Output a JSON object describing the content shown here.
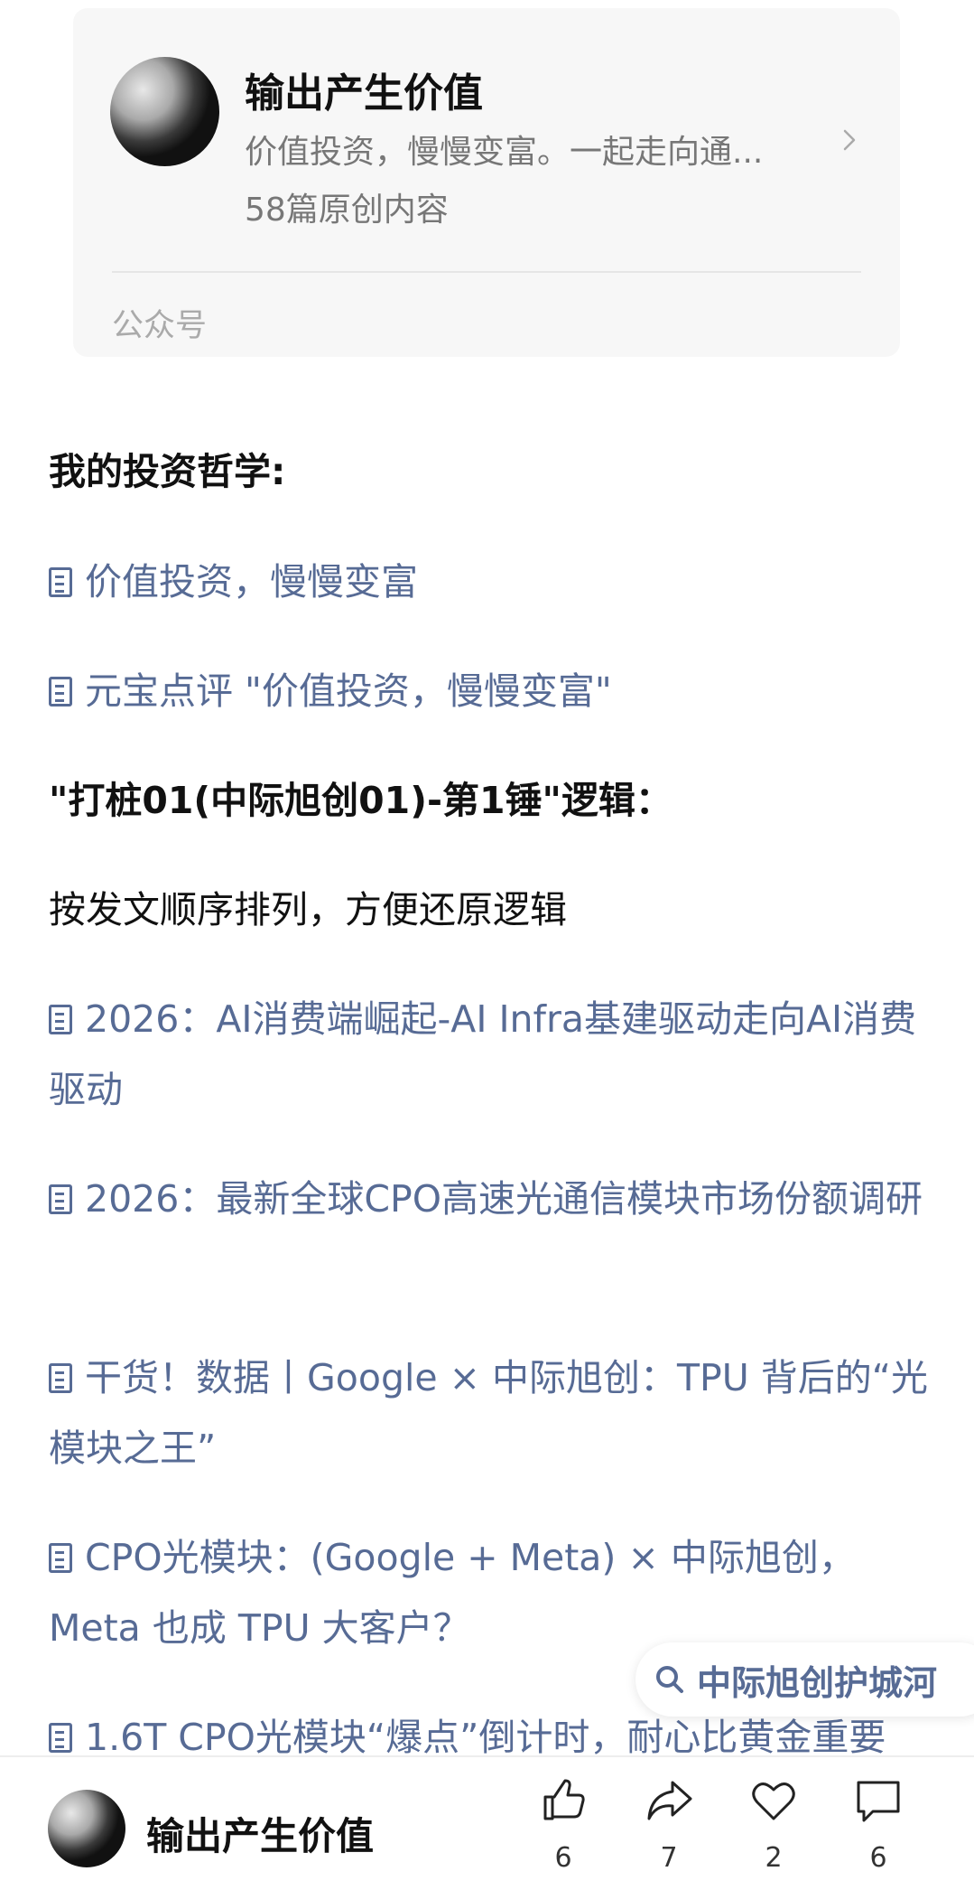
{
  "account_card": {
    "name": "输出产生价值",
    "description": "价值投资，慢慢变富。一起走向通...",
    "original_count": "58篇原创内容",
    "type_label": "公众号"
  },
  "article": {
    "heading_philosophy": "我的投资哲学:",
    "links_philosophy": [
      "价值投资，慢慢变富",
      "元宝点评 \"价值投资，慢慢变富\""
    ],
    "heading_logic": "\"打桩01(中际旭创01)-第1锤\"逻辑：",
    "note": "按发文顺序排列，方便还原逻辑",
    "links_logic": [
      "2026：AI消费端崛起-AI Infra基建驱动走向AI消费驱动",
      "2026：最新全球CPO高速光通信模块市场份额调研",
      "干货！数据丨Google × 中际旭创：TPU 背后的“光模块之王”",
      "CPO光模块：(Google + Meta) × 中际旭创，Meta 也成 TPU 大客户？",
      "1.6T CPO光模块“爆点”倒计时，耐心比黄金重要"
    ]
  },
  "search_chip": {
    "label": "中际旭创护城河",
    "icon": "search-icon"
  },
  "bottom_bar": {
    "name": "输出产生价值",
    "like_count": "6",
    "share_count": "7",
    "favorite_count": "2",
    "comment_count": "6"
  },
  "colors": {
    "link": "#576b95",
    "card_bg": "#f7f7f7",
    "secondary_text": "#777777"
  }
}
